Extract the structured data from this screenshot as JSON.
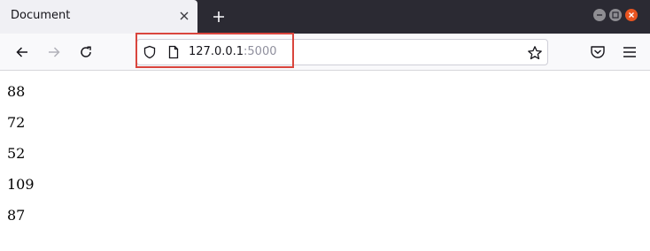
{
  "window": {
    "tab_title": "Document"
  },
  "toolbar": {
    "url_host": "127.0.0.1",
    "url_port": ":5000"
  },
  "content": {
    "lines": [
      "88",
      "72",
      "52",
      "109",
      "87"
    ]
  },
  "colors": {
    "highlight": "#d9453d",
    "close_button": "#e95420",
    "tabstrip": "#2b2a33"
  },
  "icons": [
    "close-icon",
    "plus-icon",
    "back-arrow-icon",
    "forward-arrow-icon",
    "reload-icon",
    "shield-icon",
    "page-icon",
    "star-icon",
    "pocket-icon",
    "hamburger-menu-icon"
  ]
}
